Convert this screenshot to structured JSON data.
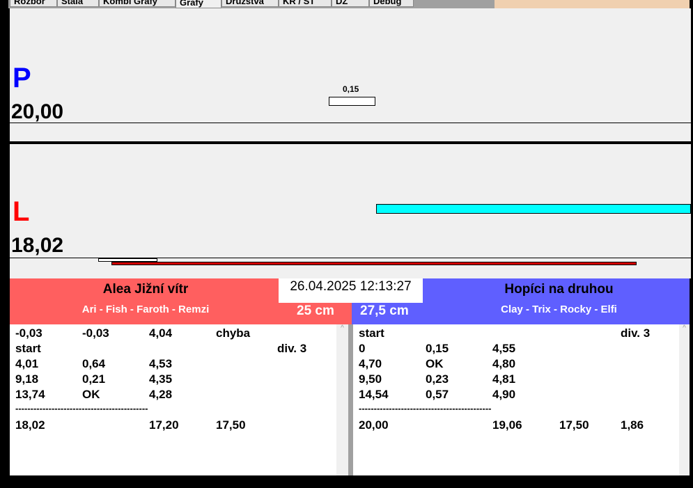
{
  "tabs": [
    "Rozbor",
    "Stála",
    "Kombi Grafy",
    "Grafy",
    "Družstva",
    "KR / ST",
    "DZ",
    "Debug"
  ],
  "graph": {
    "top": {
      "letter": "P",
      "score": "20,00",
      "marker_label": "0,15",
      "color": "#0000ff"
    },
    "bottom": {
      "letter": "L",
      "score": "18,02",
      "color": "#ff0000"
    }
  },
  "datetime": "26.04.2025 12:13:27",
  "left_team": {
    "name": "Alea Jižní vítr",
    "players": "Ari - Fish - Faroth - Remzi",
    "distance": "25 cm",
    "color": "#ff5f5f",
    "rows": [
      [
        "-0,03",
        "-0,03",
        "4,04",
        "chyba",
        ""
      ],
      [
        "start",
        "",
        "",
        "",
        "div.  3"
      ],
      [
        "4,01",
        "0,64",
        "4,53",
        "",
        ""
      ],
      [
        "9,18",
        "0,21",
        "4,35",
        "",
        ""
      ],
      [
        "13,74",
        "OK",
        "4,28",
        "",
        ""
      ]
    ],
    "separator": "--------------------------------------------",
    "total": [
      "18,02",
      "",
      "17,20",
      "17,50",
      ""
    ]
  },
  "right_team": {
    "name": "Hopíci na druhou",
    "players": "Clay - Trix - Rocky - Elfi",
    "distance": "27,5 cm",
    "color": "#5f5fff",
    "rows": [
      [
        "start",
        "",
        "",
        "",
        "div.  3"
      ],
      [
        "0",
        "0,15",
        "4,55",
        "",
        ""
      ],
      [
        "4,70",
        "OK",
        "4,80",
        "",
        ""
      ],
      [
        "9,50",
        "0,23",
        "4,81",
        "",
        ""
      ],
      [
        "14,54",
        "0,57",
        "4,90",
        "",
        ""
      ]
    ],
    "separator": "--------------------------------------------",
    "total": [
      "20,00",
      "",
      "19,06",
      "17,50",
      "1,86"
    ]
  }
}
